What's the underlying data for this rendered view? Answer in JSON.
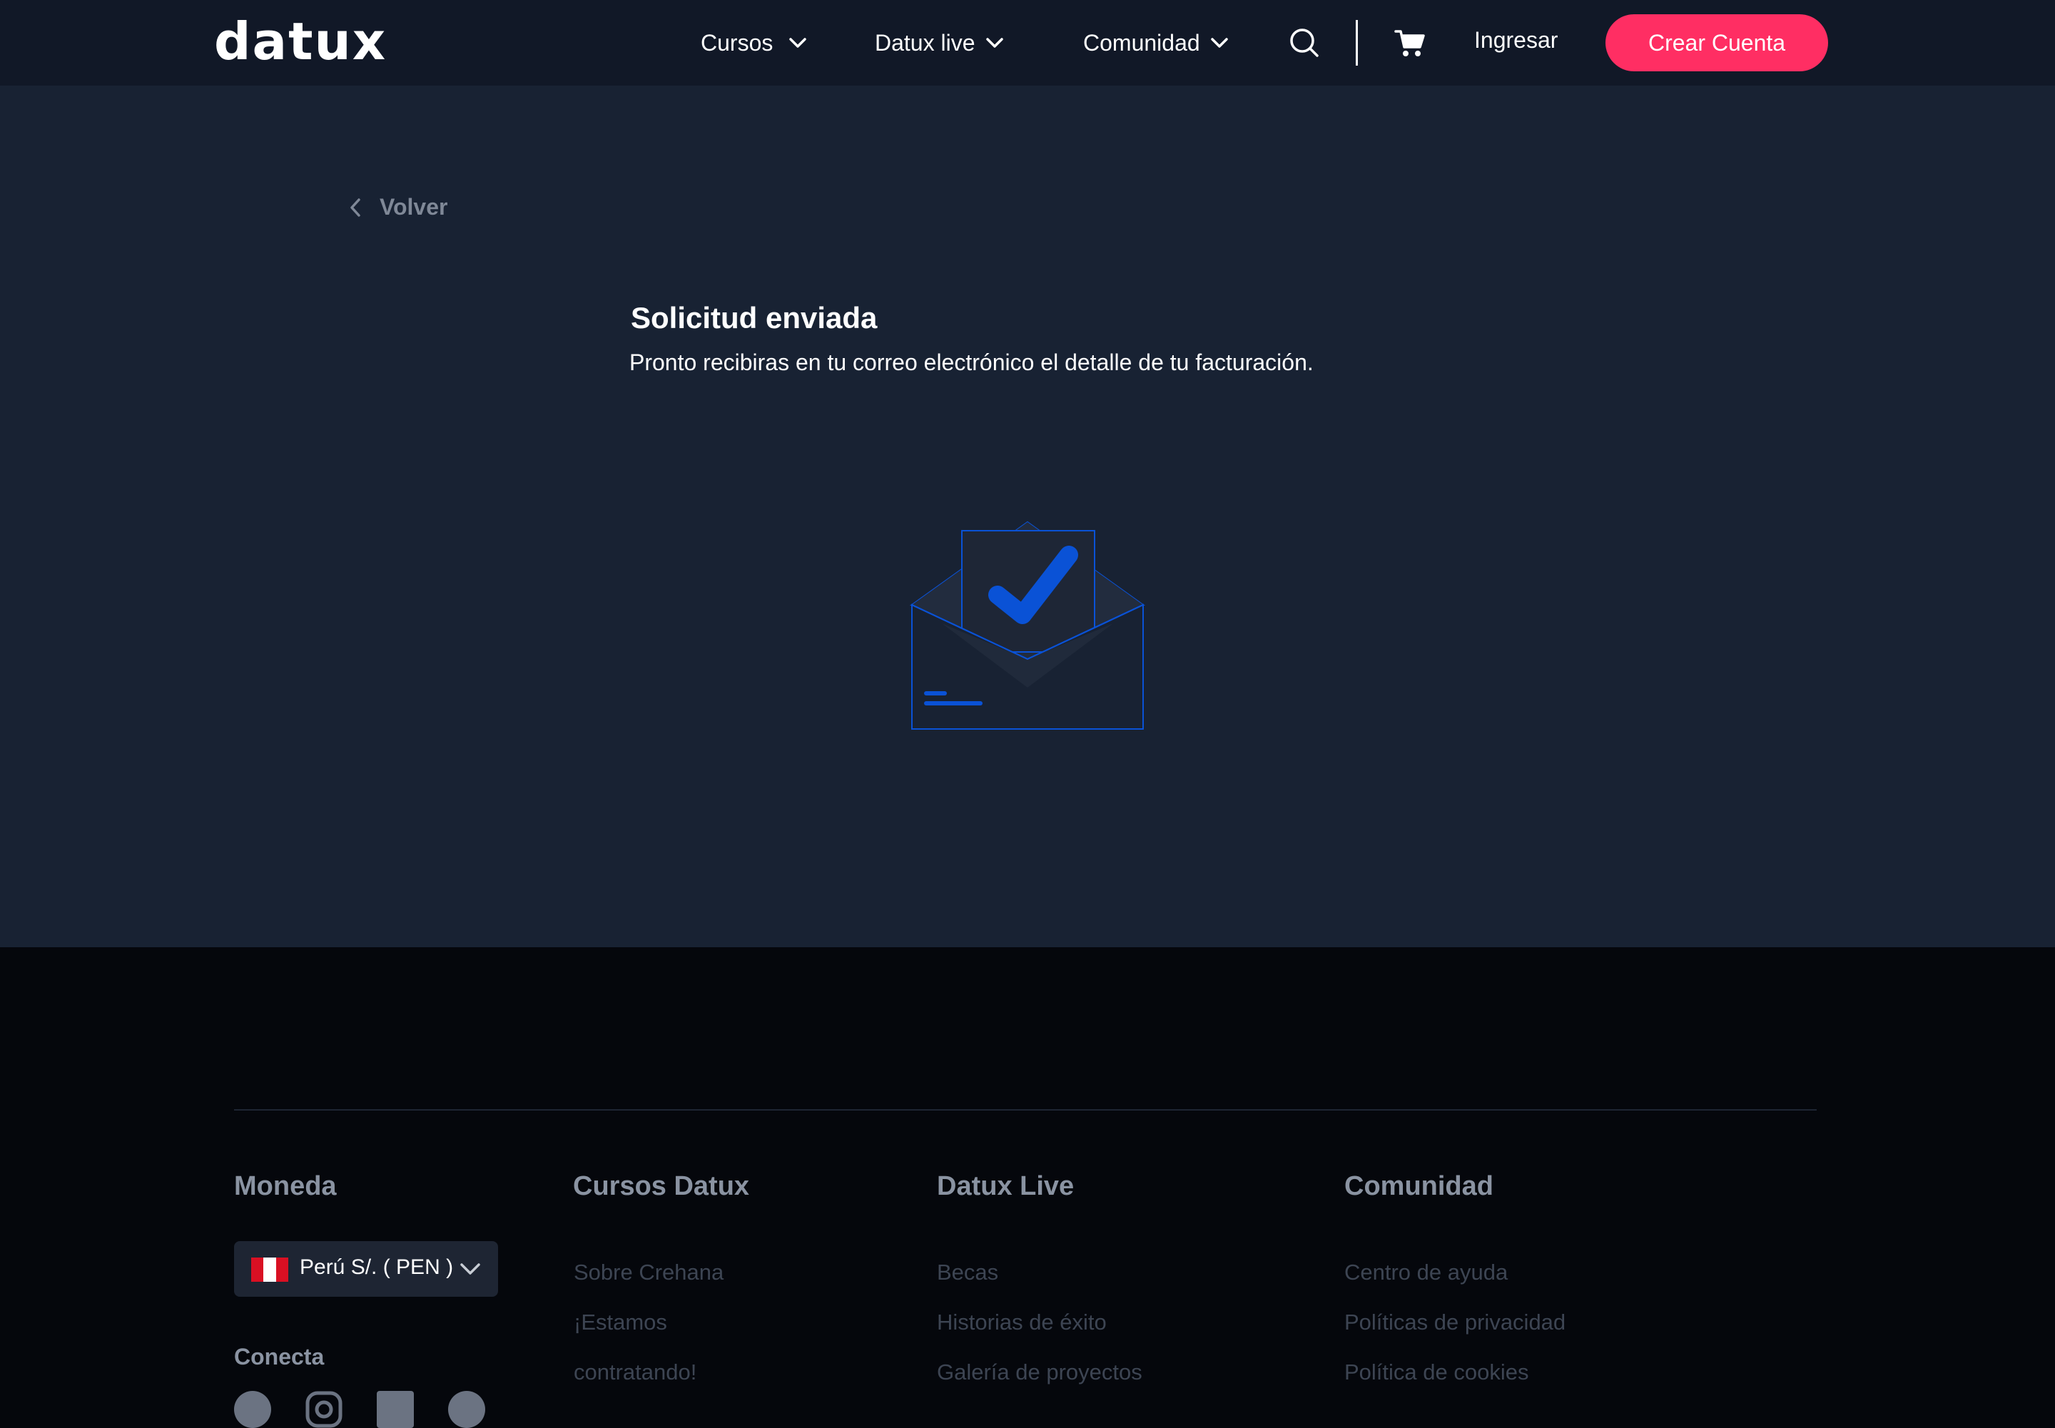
{
  "header": {
    "logo": "datux",
    "nav": [
      {
        "label": "Cursos"
      },
      {
        "label": "Datux live"
      },
      {
        "label": "Comunidad"
      }
    ],
    "login_label": "Ingresar",
    "signup_label": "Crear Cuenta"
  },
  "main": {
    "back_label": "Volver",
    "title": "Solicitud enviada",
    "subtitle": "Pronto recibiras en tu correo electrónico el detalle de tu facturación."
  },
  "footer": {
    "currency": {
      "title": "Moneda",
      "selected": "Perú S/. ( PEN )",
      "connect_title": "Conecta"
    },
    "columns": [
      {
        "title": "Cursos Datux",
        "links": [
          "Sobre Crehana",
          "¡Estamos",
          "contratando!"
        ]
      },
      {
        "title": "Datux Live",
        "links": [
          "Becas",
          "Historias de éxito",
          "Galería de proyectos"
        ]
      },
      {
        "title": "Comunidad",
        "links": [
          "Centro de ayuda",
          "Políticas de privacidad",
          "Política de cookies"
        ]
      }
    ]
  },
  "colors": {
    "header_bg": "#111827",
    "main_bg": "#182233",
    "footer_bg": "#05070c",
    "accent": "#ff2e63",
    "check_blue": "#0a52d6"
  },
  "icons": [
    "chevron-down-icon",
    "search-icon",
    "cart-icon",
    "chevron-left-icon",
    "envelope-check-icon",
    "peru-flag-icon",
    "facebook-icon",
    "instagram-icon",
    "linkedin-icon",
    "social-icon"
  ]
}
